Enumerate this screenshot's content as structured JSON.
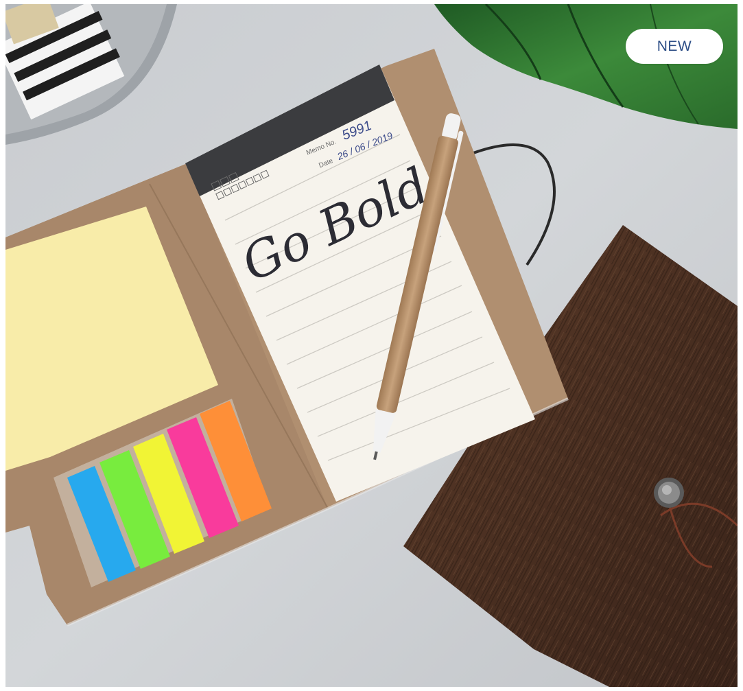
{
  "badge": {
    "label": "NEW"
  },
  "memo": {
    "memo_label": "Memo No.",
    "memo_number": "5991",
    "date_label": "Date",
    "date_value": "26 / 06 / 2019",
    "handwriting": "Go Bold"
  },
  "colors": {
    "background": "#cdd0d3",
    "kraft": "#b08f70",
    "sticky_note": "#f8eca9",
    "flag_colors": [
      "#27a9ee",
      "#78ec3e",
      "#f1f435",
      "#f93b9c",
      "#fe8f38"
    ],
    "wood_cover": "#4a3123",
    "badge_text": "#2d4e86"
  }
}
